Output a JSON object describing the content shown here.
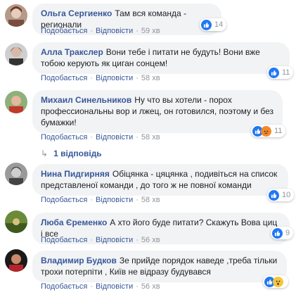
{
  "actions": {
    "like": "Подобається",
    "reply": "Відповісти",
    "sep": "·"
  },
  "comments": [
    {
      "author": "Ольга Сергиенко",
      "text": "Там вся команда - регионали",
      "time": "59 хв",
      "reactions": "14"
    },
    {
      "author": "Алла Тракслер",
      "text": "Вони тебе і питати не будуть! Вони вже тобою керують як циган сонцем!",
      "time": "58 хв",
      "reactions": "11"
    },
    {
      "author": "Михаил Синельников",
      "text": "Ну что вы хотели - порох профессиональны вор и лжец, он готовился, поэтому и без бумажки!",
      "time": "58 хв",
      "reactions": "11"
    },
    {
      "author": "Нина Пидгирняя",
      "text": "Обіцянка - цяцянка , подивіться на список представленої команди , до того ж не повної команди",
      "time": "58 хв",
      "reactions": "10"
    },
    {
      "author": "Люба Єременко",
      "text": "А хто його буде питати? Скажуть Вова циц і все",
      "time": "56 хв",
      "reactions": "9"
    },
    {
      "author": "Владимир Будков",
      "text": "Зе прийде порядок наведе ,треба тільки трохи потерпіти , Київ не відразу будувався",
      "time": "56 хв",
      "reactions": ""
    }
  ],
  "replies": {
    "label": "1 відповідь"
  },
  "colors": {
    "link": "#385898",
    "bubble": "#f2f3f5",
    "like": "#2078f4",
    "meta": "#90949c"
  }
}
